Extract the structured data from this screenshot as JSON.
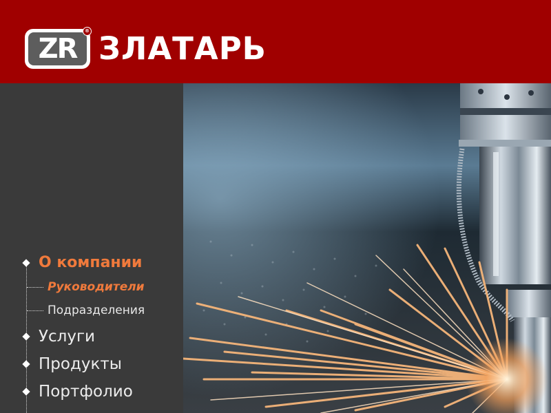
{
  "logo": {
    "badge_text": "ZR",
    "reg_mark": "®",
    "name": "ЗЛАТАРЬ"
  },
  "nav": {
    "items": [
      {
        "label": "О компании",
        "active": true
      },
      {
        "label": "Услуги",
        "active": false
      },
      {
        "label": "Продукты",
        "active": false
      },
      {
        "label": "Портфолио",
        "active": false
      }
    ],
    "subitems": [
      {
        "label": "Руководители",
        "active": true
      },
      {
        "label": "Подразделения",
        "active": false
      }
    ]
  },
  "colors": {
    "header_bg": "#a00000",
    "sidebar_bg": "#3a3a3a",
    "accent": "#f07a3c"
  },
  "hero": {
    "subject": "laser-cutting-machine-sparks"
  }
}
